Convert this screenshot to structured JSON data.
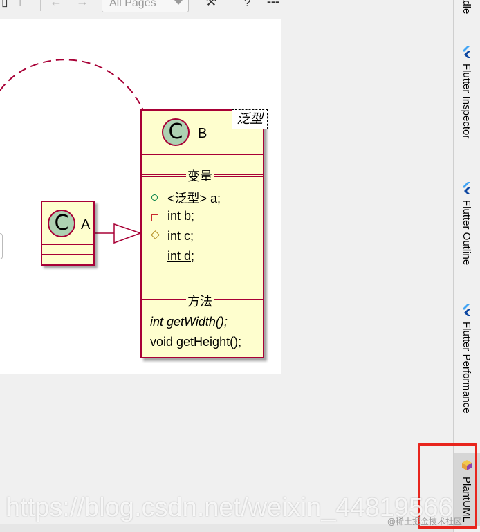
{
  "toolbar": {
    "scope_select_value": "All Pages",
    "help_label": "?",
    "more_label": "---"
  },
  "diagram": {
    "class_a": {
      "icon_letter": "C",
      "name": "A"
    },
    "class_b": {
      "icon_letter": "C",
      "name": "B",
      "generic_param": "泛型",
      "fields_title": "变量",
      "fields": [
        {
          "visibility": "public",
          "text": "<泛型>  a;"
        },
        {
          "visibility": "private",
          "text": "int b;"
        },
        {
          "visibility": "protected",
          "text": "int c;"
        },
        {
          "visibility": "package",
          "text": "int d;",
          "static": true
        }
      ],
      "methods_title": "方法",
      "methods": [
        {
          "text": "int getWidth();",
          "abstract": true
        },
        {
          "text": "void getHeight();",
          "abstract": false
        }
      ]
    },
    "colors": {
      "border": "#a80036",
      "class_fill": "#fefece",
      "icon_fill": "#add1b2"
    }
  },
  "tool_windows": {
    "top_cut_label": "adle",
    "tabs": [
      {
        "label": "Flutter Inspector",
        "icon": "flutter-icon"
      },
      {
        "label": "Flutter Outline",
        "icon": "flutter-icon"
      },
      {
        "label": "Flutter Performance",
        "icon": "flutter-icon"
      },
      {
        "label": "PlantUML",
        "icon": "plantuml-icon"
      }
    ]
  },
  "watermark": {
    "url": "https://blog.csdn.net/weixin_44819566",
    "site": "@稀土掘金技术社区"
  }
}
